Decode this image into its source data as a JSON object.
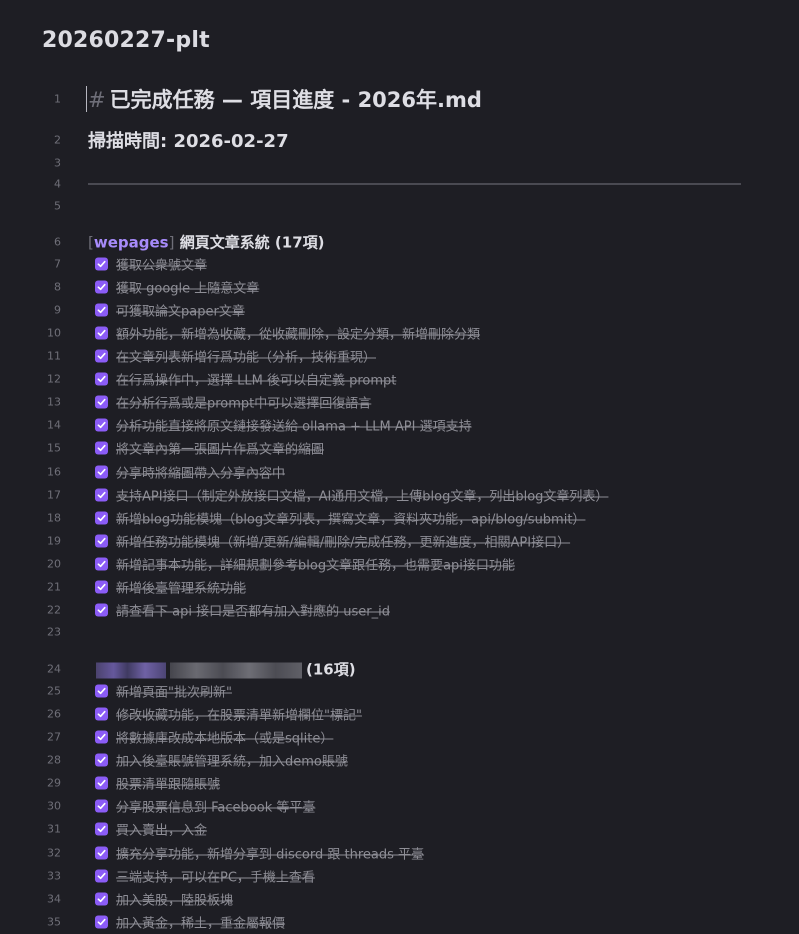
{
  "file_title": "20260227-plt",
  "heading": {
    "hash": "#",
    "title": "已完成任務 — 項目進度 - 2026年.md"
  },
  "scan_time": "掃描時間: 2026-02-27",
  "line_numbers": [
    "1",
    "2",
    "3",
    "4",
    "5",
    "6",
    "7",
    "8",
    "9",
    "10",
    "11",
    "12",
    "13",
    "14",
    "15",
    "16",
    "17",
    "18",
    "19",
    "20",
    "21",
    "22",
    "23",
    "24",
    "25",
    "26",
    "27",
    "28",
    "29",
    "30",
    "31",
    "32",
    "33",
    "34",
    "35"
  ],
  "section1": {
    "bracket_open": "[",
    "tag": "wepages",
    "bracket_close": "]",
    "title": "網頁文章系統 (17項)",
    "tasks": [
      "獲取公衆號文章",
      "獲取 google 上隨意文章",
      "可獲取論文paper文章",
      "額外功能，新增為收藏，從收藏刪除，設定分類，新增刪除分類",
      "在文章列表新增行爲功能（分析，技術重現）",
      "在行爲操作中，選擇 LLM 後可以自定義 prompt",
      "在分析行爲或是prompt中可以選擇回復語言",
      "分析功能直接將原文鏈接發送給 ollama + LLM API 選項支持",
      "將文章內第一張圖片作爲文章的縮圖",
      "分享時將縮圖帶入分享內容中",
      "支持API接口（制定外放接口文檔，AI通用文檔，上傳blog文章，列出blog文章列表）",
      "新增blog功能模塊（blog文章列表，撰寫文章，資料夾功能，api/blog/submit）",
      "新增任務功能模塊（新增/更新/編輯/刪除/完成任務，更新進度，相關API接口）",
      "新增記事本功能，詳細規劃參考blog文章跟任務，也需要api接口功能",
      "新增後臺管理系統功能",
      "請查看下 api 接口是否都有加入對應的 user_id"
    ]
  },
  "section2": {
    "title": "(16項)",
    "tasks": [
      "新增頁面\"批次刷新\"",
      "修改收藏功能，在股票清單新增欄位\"標記\"",
      "將數據庫改成本地版本（或是sqlite）",
      "加入後臺賬號管理系統，加入demo賬號",
      "股票清單跟隨賬號",
      "分享股票信息到 Facebook 等平臺",
      "買入賣出，入金",
      "擴充分享功能，新增分享到 discord 跟 threads 平臺",
      "三端支持，可以在PC，手機上查看",
      "加入美股，陸股板塊",
      "加入黃金，稀土，重金屬報價"
    ]
  },
  "colors": {
    "background": "#1e1e24",
    "accent": "#8b5cf6",
    "tag": "#a78bfa",
    "done_text": "#8e8e96",
    "line_number": "#6f6f78"
  }
}
